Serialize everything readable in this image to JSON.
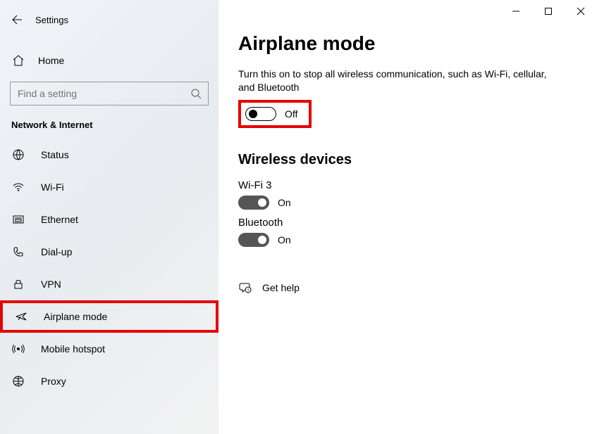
{
  "window_title": "Settings",
  "home_label": "Home",
  "search_placeholder": "Find a setting",
  "section_title": "Network & Internet",
  "nav_items": [
    {
      "label": "Status"
    },
    {
      "label": "Wi-Fi"
    },
    {
      "label": "Ethernet"
    },
    {
      "label": "Dial-up"
    },
    {
      "label": "VPN"
    },
    {
      "label": "Airplane mode"
    },
    {
      "label": "Mobile hotspot"
    },
    {
      "label": "Proxy"
    }
  ],
  "main": {
    "title": "Airplane mode",
    "description": "Turn this on to stop all wireless communication, such as Wi-Fi, cellular, and Bluetooth",
    "toggle_state": "Off",
    "wireless_heading": "Wireless devices",
    "devices": [
      {
        "name": "Wi-Fi 3",
        "state": "On"
      },
      {
        "name": "Bluetooth",
        "state": "On"
      }
    ],
    "help_label": "Get help"
  }
}
